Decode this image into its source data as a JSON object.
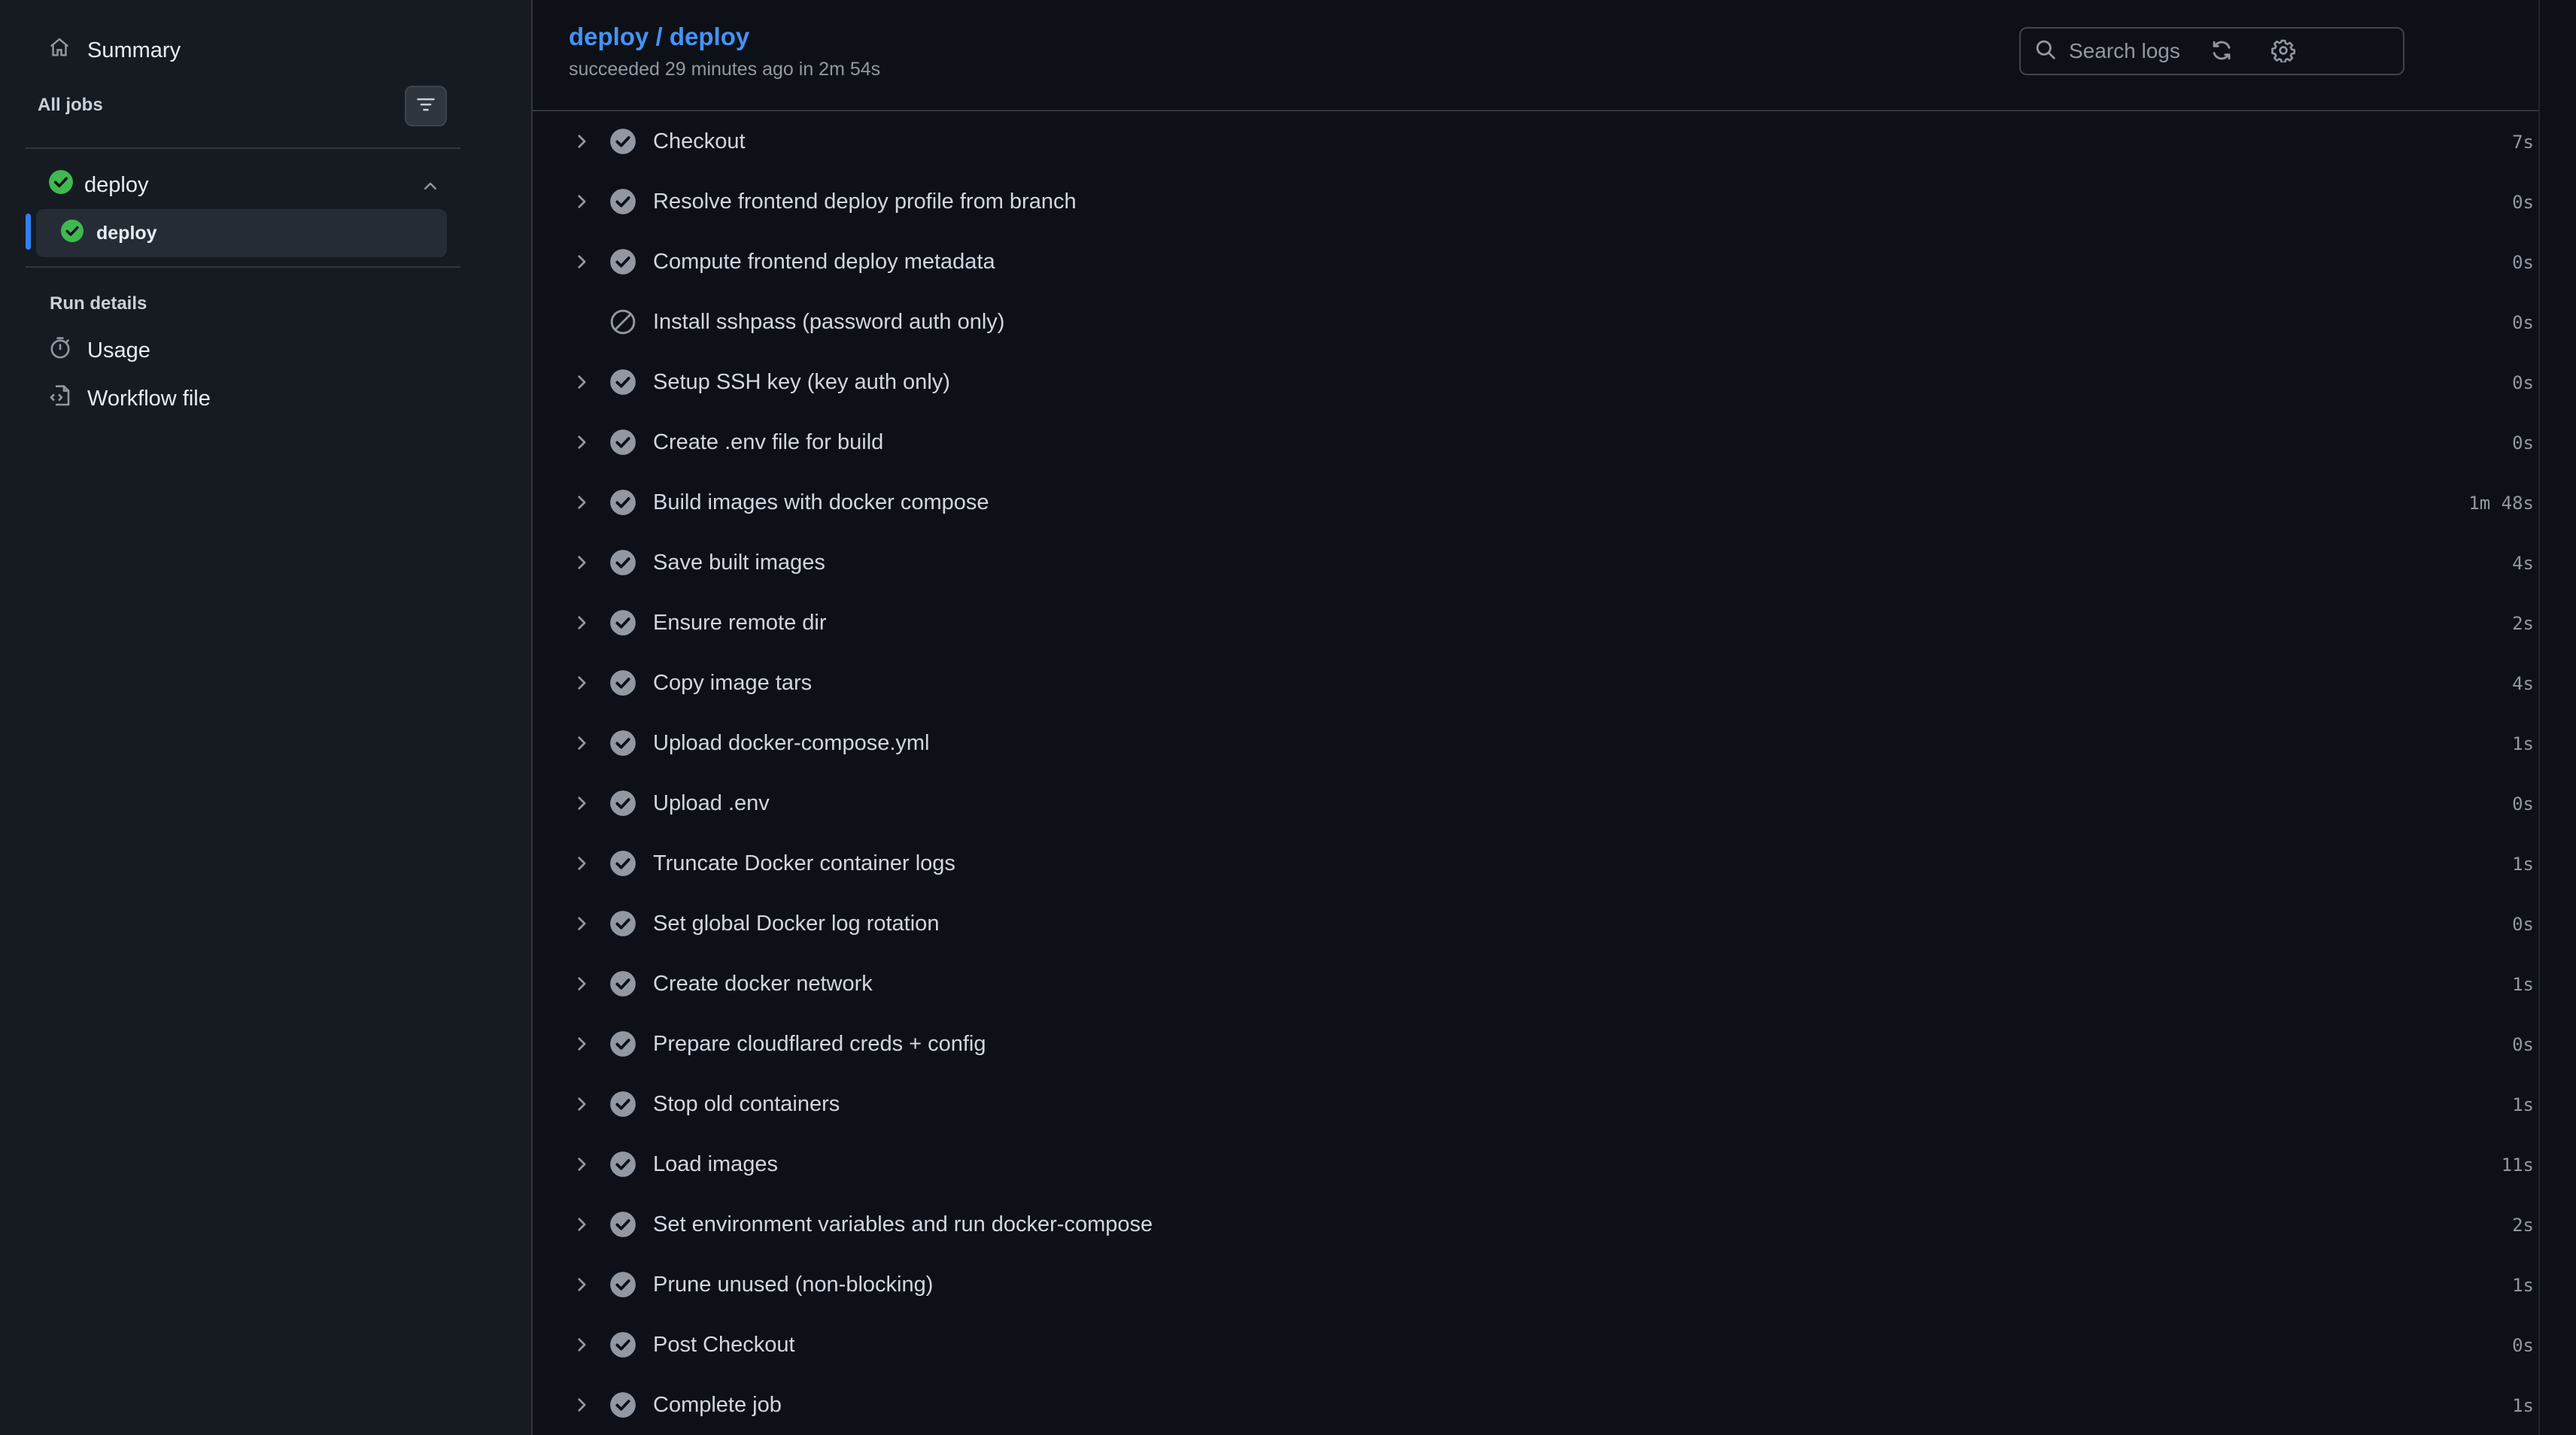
{
  "sidebar": {
    "summary_label": "Summary",
    "all_jobs_label": "All jobs",
    "job_group": {
      "label": "deploy",
      "status": "success"
    },
    "job": {
      "label": "deploy",
      "status": "success",
      "selected": true
    },
    "run_details_label": "Run details",
    "links": [
      {
        "label": "Usage",
        "icon": "stopwatch-icon"
      },
      {
        "label": "Workflow file",
        "icon": "workflow-file-icon"
      }
    ]
  },
  "header": {
    "title": "deploy / deploy",
    "subtitle": "succeeded 29 minutes ago in 2m 54s",
    "search_placeholder": "Search logs"
  },
  "steps": [
    {
      "name": "Checkout",
      "duration": "7s",
      "status": "success",
      "expandable": true
    },
    {
      "name": "Resolve frontend deploy profile from branch",
      "duration": "0s",
      "status": "success",
      "expandable": true
    },
    {
      "name": "Compute frontend deploy metadata",
      "duration": "0s",
      "status": "success",
      "expandable": true
    },
    {
      "name": "Install sshpass (password auth only)",
      "duration": "0s",
      "status": "skipped",
      "expandable": false
    },
    {
      "name": "Setup SSH key (key auth only)",
      "duration": "0s",
      "status": "success",
      "expandable": true
    },
    {
      "name": "Create .env file for build",
      "duration": "0s",
      "status": "success",
      "expandable": true
    },
    {
      "name": "Build images with docker compose",
      "duration": "1m 48s",
      "status": "success",
      "expandable": true
    },
    {
      "name": "Save built images",
      "duration": "4s",
      "status": "success",
      "expandable": true
    },
    {
      "name": "Ensure remote dir",
      "duration": "2s",
      "status": "success",
      "expandable": true
    },
    {
      "name": "Copy image tars",
      "duration": "4s",
      "status": "success",
      "expandable": true
    },
    {
      "name": "Upload docker-compose.yml",
      "duration": "1s",
      "status": "success",
      "expandable": true
    },
    {
      "name": "Upload .env",
      "duration": "0s",
      "status": "success",
      "expandable": true
    },
    {
      "name": "Truncate Docker container logs",
      "duration": "1s",
      "status": "success",
      "expandable": true
    },
    {
      "name": "Set global Docker log rotation",
      "duration": "0s",
      "status": "success",
      "expandable": true
    },
    {
      "name": "Create docker network",
      "duration": "1s",
      "status": "success",
      "expandable": true
    },
    {
      "name": "Prepare cloudflared creds + config",
      "duration": "0s",
      "status": "success",
      "expandable": true
    },
    {
      "name": "Stop old containers",
      "duration": "1s",
      "status": "success",
      "expandable": true
    },
    {
      "name": "Load images",
      "duration": "11s",
      "status": "success",
      "expandable": true
    },
    {
      "name": "Set environment variables and run docker-compose",
      "duration": "2s",
      "status": "success",
      "expandable": true
    },
    {
      "name": "Prune unused (non-blocking)",
      "duration": "1s",
      "status": "success",
      "expandable": true
    },
    {
      "name": "Post Checkout",
      "duration": "0s",
      "status": "success",
      "expandable": true
    },
    {
      "name": "Complete job",
      "duration": "1s",
      "status": "success",
      "expandable": true
    }
  ],
  "colors": {
    "background": "#0d1117",
    "sidebar_bg": "#161b22",
    "accent_link": "#4493f8",
    "success_green": "#3fb950",
    "step_check_gray": "#9198a1",
    "selected_bar": "#2f81f7"
  }
}
